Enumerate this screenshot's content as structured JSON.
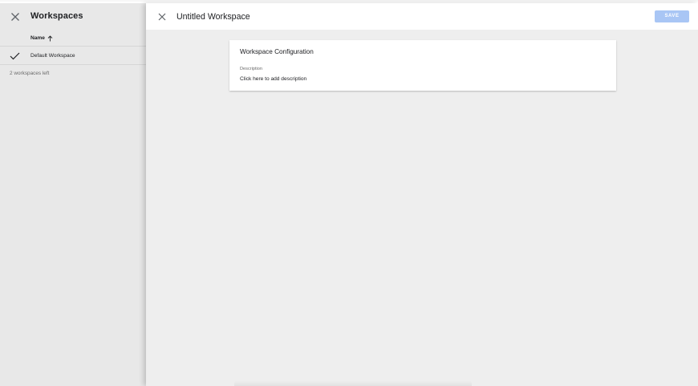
{
  "left_panel": {
    "title": "Workspaces",
    "column_header": "Name",
    "rows": [
      {
        "label": "Default Workspace",
        "selected": true
      }
    ],
    "footer": "2 workspaces left"
  },
  "right_panel": {
    "title": "Untitled Workspace",
    "save_label": "SAVE",
    "card": {
      "title": "Workspace Configuration",
      "description_label": "Description",
      "description_value": "Click here to add description"
    }
  },
  "icons": {
    "close": "close-icon",
    "sort": "arrow-up-icon",
    "check": "check-icon"
  },
  "colors": {
    "save_button": "#a9c6f5",
    "left_panel_bg": "#e8e8e8",
    "right_panel_bg": "#eeeeee"
  }
}
